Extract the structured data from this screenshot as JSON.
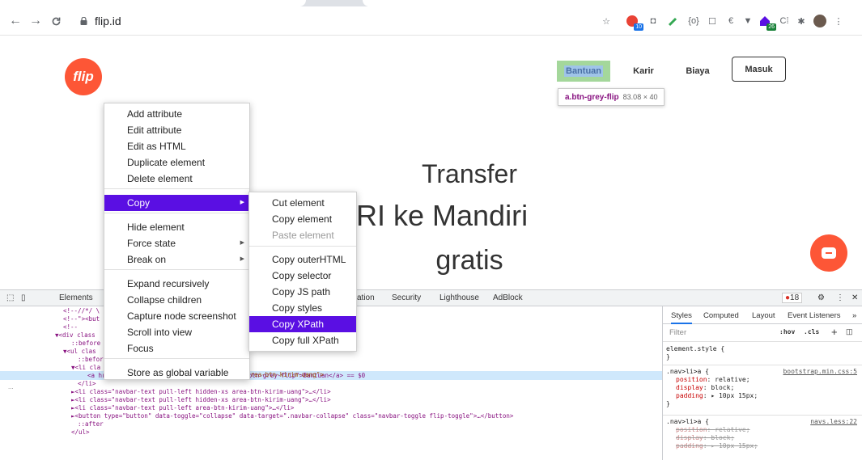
{
  "browser": {
    "url": "flip.id",
    "ext_badges": {
      "b1": "10",
      "b2": "26"
    }
  },
  "page": {
    "logo": "flip",
    "nav": {
      "bantuan": "Bantuan",
      "karir": "Karir",
      "biaya": "Biaya",
      "masuk": "Masuk"
    },
    "inspect_tip": {
      "selector": "a.btn-grey-flip",
      "size": "83.08 × 40"
    },
    "hero": {
      "line1": "Transfer",
      "line2": "RI ke Mandiri",
      "line3": "gratis"
    }
  },
  "devtools": {
    "tabs": {
      "elements": "Elements",
      "ation": "ation",
      "security": "Security",
      "lighthouse": "Lighthouse",
      "adblock": "AdBlock"
    },
    "issues_count": "18",
    "styles_tabs": {
      "styles": "Styles",
      "computed": "Computed",
      "layout": "Layout",
      "listeners": "Event Listeners",
      "more": "»"
    },
    "filter_placeholder": "Filter",
    "filter_tools": {
      "hov": ":hov",
      "cls": ".cls",
      "plus": "+"
    },
    "dom_lines": [
      {
        "indent": 78,
        "html": "<!--//*/ \\"
      },
      {
        "indent": 78,
        "html": "<!--\"><but"
      },
      {
        "indent": 78,
        "html": "<!--"
      },
      {
        "indent": 68,
        "html": "▼<div class"
      },
      {
        "indent": 88,
        "html": "::before"
      },
      {
        "indent": 78,
        "html": "▼<ul clas"
      },
      {
        "indent": 96,
        "html": "::befor"
      },
      {
        "indent": 88,
        "html": "▼<li cla"
      },
      {
        "indent": 108,
        "html": "<a href=\"https://flipid.zendesk.com\" class=\"btn-grey-flip\">Bantuan</a> == $0"
      },
      {
        "indent": 96,
        "html": "</li>"
      },
      {
        "indent": 88,
        "html": "►<li class=\"navbar-text pull-left hidden-xs area-btn-kirim-uang\">…</li>"
      },
      {
        "indent": 88,
        "html": "►<li class=\"navbar-text pull-left hidden-xs area-btn-kirim-uang\">…</li>"
      },
      {
        "indent": 88,
        "html": "►<li class=\"navbar-text pull-left area-btn-kirim-uang\">…</li>"
      },
      {
        "indent": 88,
        "html": "►<button type=\"button\" data-toggle=\"collapse\" data-target=\".navbar-collapse\" class=\"navbar-toggle flip-toggle\">…</button>"
      },
      {
        "indent": 96,
        "html": "::after"
      },
      {
        "indent": 88,
        "html": "</ul>"
      }
    ],
    "li_tail": "s area-btn-kirim-uang\">",
    "ellipsis": "...",
    "styles": {
      "element_style": "element.style {",
      "close": "}",
      "rule1_selector": ".nav>li>a {",
      "rule1_source": "bootstrap.min.css:5",
      "rule1_props": [
        {
          "name": "position",
          "value": "relative;"
        },
        {
          "name": "display",
          "value": "block;"
        },
        {
          "name": "padding",
          "value": "▸ 10px 15px;"
        }
      ],
      "rule2_selector": ".nav>li>a {",
      "rule2_source": "navs.less:22",
      "rule2_props": [
        {
          "name": "position",
          "value": "relative;"
        },
        {
          "name": "display",
          "value": "block;"
        },
        {
          "name": "padding",
          "value": "▸ 10px 15px;"
        }
      ]
    }
  },
  "context_menu": {
    "items": [
      "Add attribute",
      "Edit attribute",
      "Edit as HTML",
      "Duplicate element",
      "Delete element",
      "Copy",
      "Hide element",
      "Force state",
      "Break on",
      "Expand recursively",
      "Collapse children",
      "Capture node screenshot",
      "Scroll into view",
      "Focus",
      "Store as global variable"
    ]
  },
  "copy_submenu": {
    "items": [
      "Cut element",
      "Copy element",
      "Paste element",
      "Copy outerHTML",
      "Copy selector",
      "Copy JS path",
      "Copy styles",
      "Copy XPath",
      "Copy full XPath"
    ]
  },
  "colors": {
    "brand": "#fd5636",
    "menu_highlight": "#5a0fe3"
  }
}
